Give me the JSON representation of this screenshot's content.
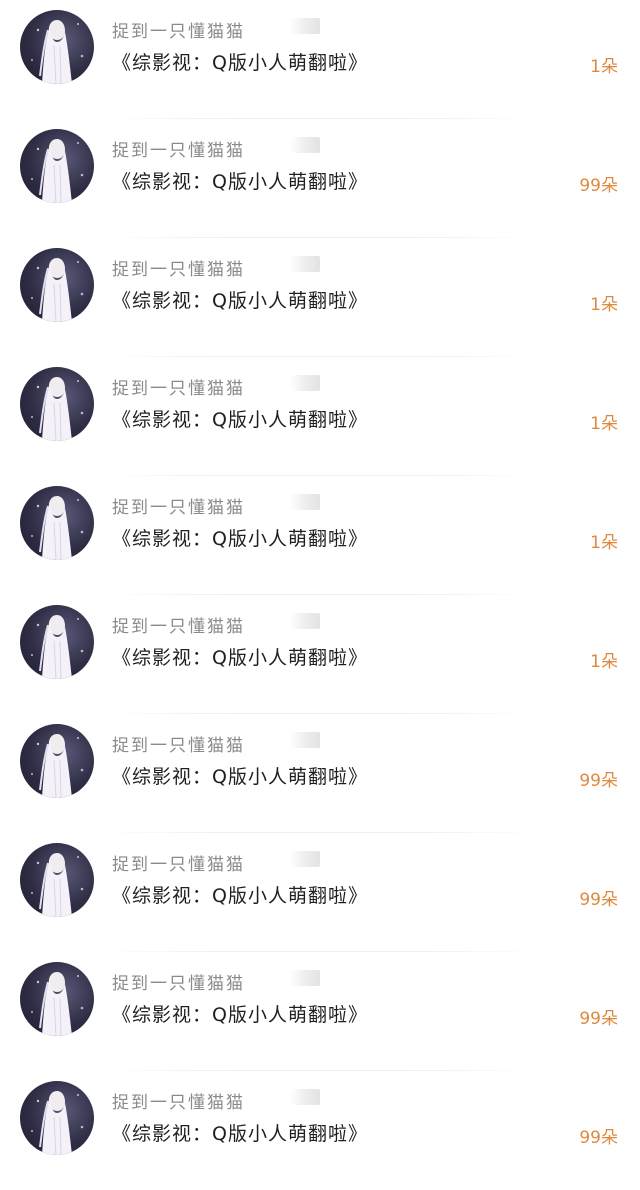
{
  "rows": [
    {
      "username": "捉到一只懂猫猫",
      "title": "《综影视：Q版小人萌翻啦》",
      "gift": "1朵"
    },
    {
      "username": "捉到一只懂猫猫",
      "title": "《综影视：Q版小人萌翻啦》",
      "gift": "99朵"
    },
    {
      "username": "捉到一只懂猫猫",
      "title": "《综影视：Q版小人萌翻啦》",
      "gift": "1朵"
    },
    {
      "username": "捉到一只懂猫猫",
      "title": "《综影视：Q版小人萌翻啦》",
      "gift": "1朵"
    },
    {
      "username": "捉到一只懂猫猫",
      "title": "《综影视：Q版小人萌翻啦》",
      "gift": "1朵"
    },
    {
      "username": "捉到一只懂猫猫",
      "title": "《综影视：Q版小人萌翻啦》",
      "gift": "1朵"
    },
    {
      "username": "捉到一只懂猫猫",
      "title": "《综影视：Q版小人萌翻啦》",
      "gift": "99朵"
    },
    {
      "username": "捉到一只懂猫猫",
      "title": "《综影视：Q版小人萌翻啦》",
      "gift": "99朵"
    },
    {
      "username": "捉到一只懂猫猫",
      "title": "《综影视：Q版小人萌翻啦》",
      "gift": "99朵"
    },
    {
      "username": "捉到一只懂猫猫",
      "title": "《综影视：Q版小人萌翻啦》",
      "gift": "99朵"
    }
  ],
  "colors": {
    "username": "#8a8a8a",
    "title": "#1f1f1f",
    "gift": "#e0893e"
  },
  "icons": {
    "avatar": "avatar-white-robed-figure"
  }
}
